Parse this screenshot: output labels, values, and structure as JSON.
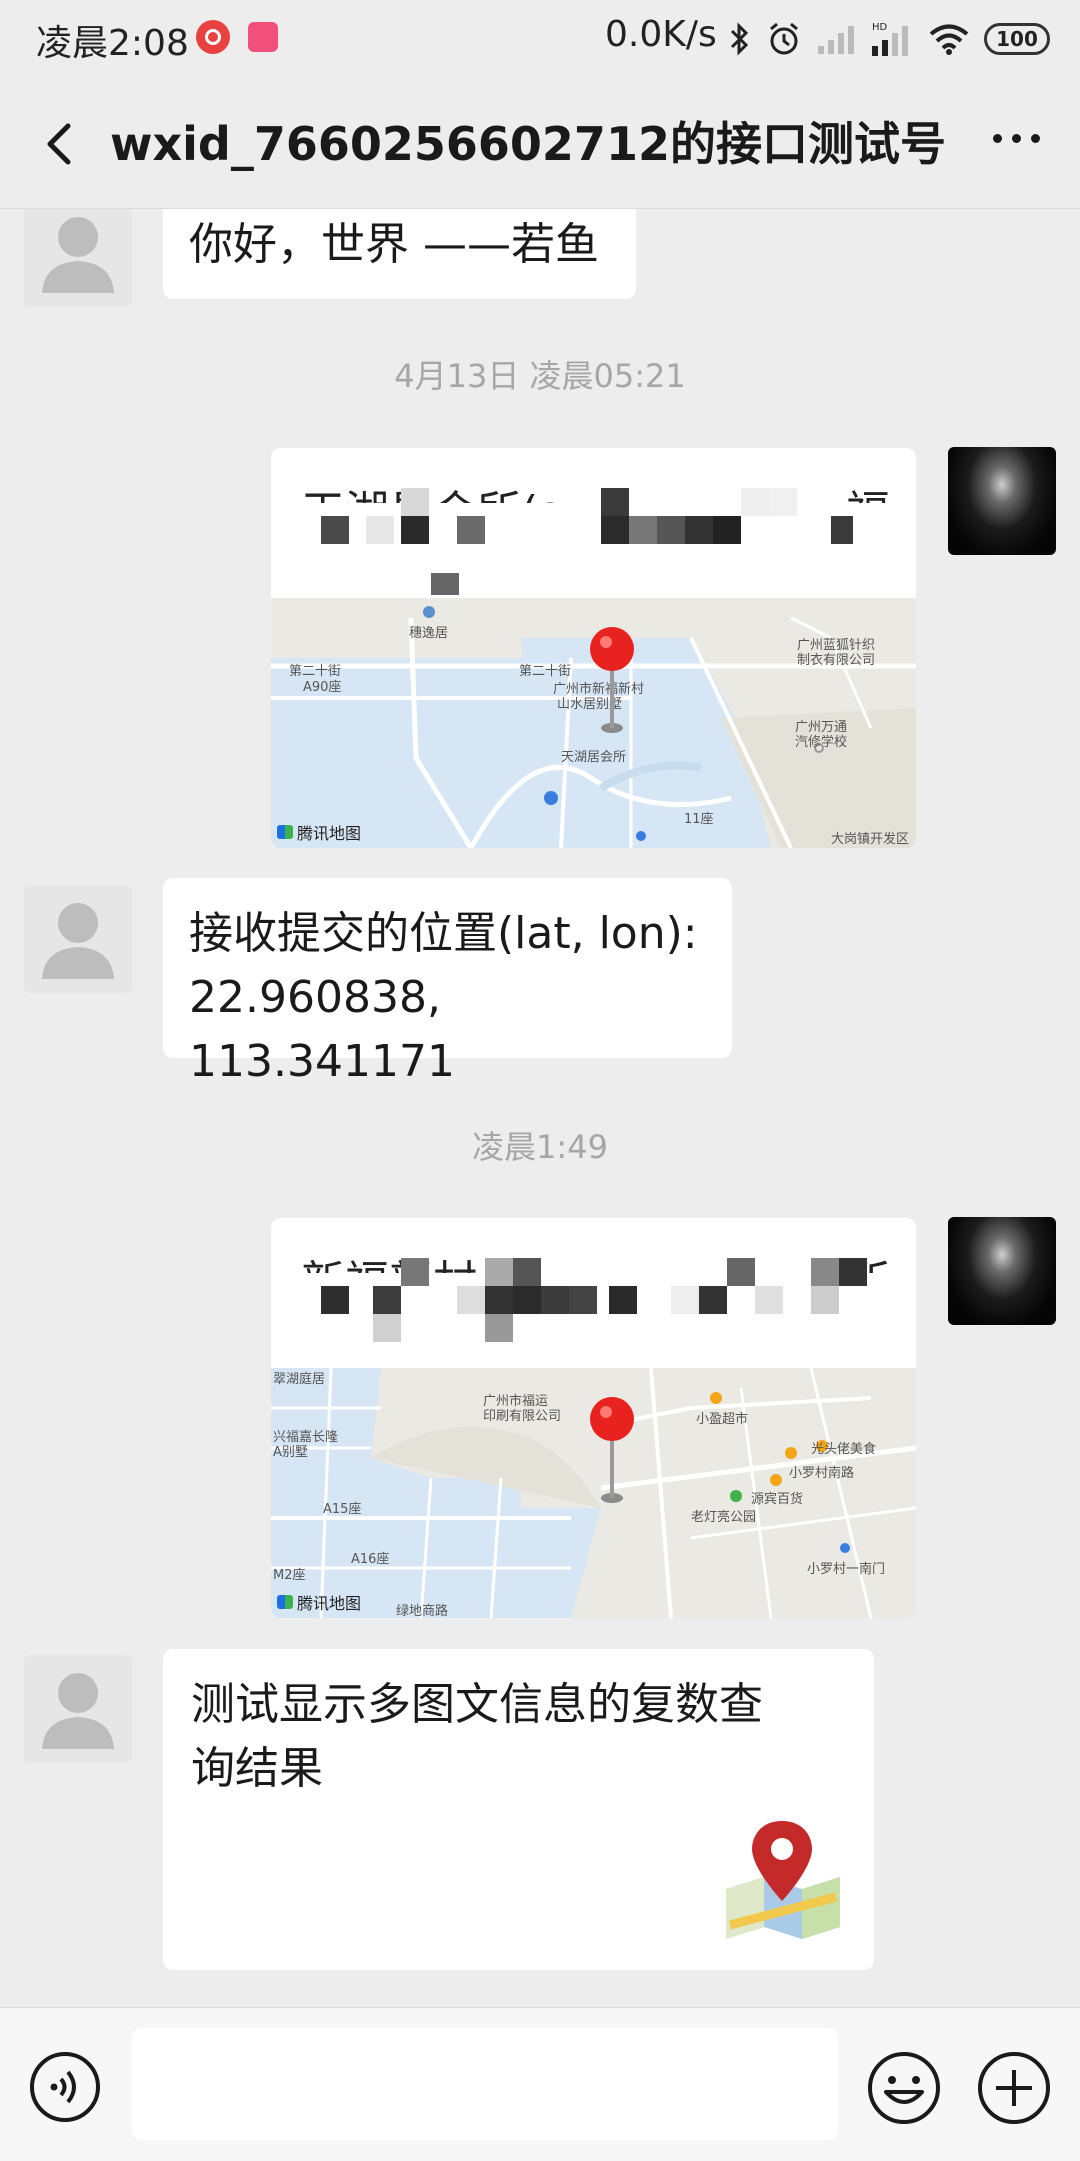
{
  "status_bar": {
    "time": "凌晨2:08",
    "net_speed": "0.0K/s",
    "battery": "100"
  },
  "header": {
    "title": "wxid_766025660271​2的接口测试号"
  },
  "messages": {
    "m1_text": "你好，世界 ——若鱼",
    "ts1": "4月13日 凌晨05:21",
    "loc1_title": "天湖星会所(s",
    "loc1_title_end": "福",
    "m2_line1": "接收提交的位置(lat, lon):",
    "m2_line2": "22.960838, 113.341171",
    "ts2": "凌晨1:49",
    "loc2_title": "新福新村",
    "loc2_title_end": "所",
    "m3_line1": "测试显示多图文信息的复数查",
    "m3_line2": "询结果"
  },
  "map1": {
    "labels": [
      "穗逸居",
      "第二十街",
      "A90座",
      "第二十街",
      "广州市新福新村",
      "山水居别墅",
      "天湖居会所",
      "广州蓝狐针织",
      "制衣有限公司",
      "广州万通",
      "汽修学校",
      "11座",
      "大岗镇开发区"
    ],
    "brand": "腾讯地图"
  },
  "map2": {
    "labels": [
      "翠湖庭居",
      "广州市福运",
      "印刷有限公司",
      "小盈超市",
      "兴福嘉长隆",
      "A别墅",
      "光头佬美食",
      "小罗村南路",
      "老灯亮公园",
      "源宾百货",
      "A15座",
      "A16座",
      "小罗村一南门",
      "M2座",
      "绿地商路"
    ],
    "brand": "腾讯地图"
  },
  "bottom": {
    "input_value": ""
  },
  "colors": {
    "bg": "#ededed",
    "bubble": "#ffffff",
    "pin": "#e8231f",
    "map_water": "#d6e6f5"
  }
}
